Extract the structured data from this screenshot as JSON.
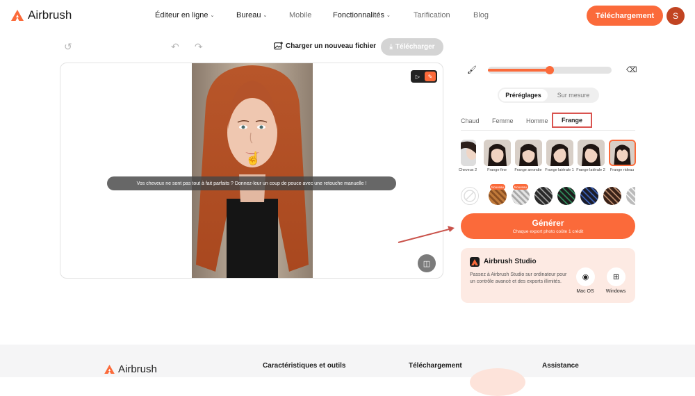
{
  "brand": {
    "name": "Airbrush",
    "accent": "#fb6a3a"
  },
  "nav": {
    "items": [
      {
        "label": "Éditeur en ligne",
        "has_dropdown": true
      },
      {
        "label": "Bureau",
        "has_dropdown": true
      },
      {
        "label": "Mobile",
        "has_dropdown": false
      },
      {
        "label": "Fonctionnalités",
        "has_dropdown": true
      },
      {
        "label": "Tarification",
        "has_dropdown": false
      },
      {
        "label": "Blog",
        "has_dropdown": false
      }
    ],
    "download_label": "Téléchargement",
    "avatar_initial": "S"
  },
  "toolbar": {
    "upload_label": "Charger un nouveau fichier",
    "download_label": "Télécharger"
  },
  "canvas": {
    "tip": "Vos cheveux ne sont pas tout à fait parfaits ? Donnez-leur un coup de pouce avec une retouche manuelle !"
  },
  "panel": {
    "brush_size": 0.5,
    "tabs": {
      "presets": "Préréglages",
      "custom": "Sur mesure"
    },
    "categories": [
      "Chaud",
      "Femme",
      "Homme",
      "Frange"
    ],
    "active_category": "Frange",
    "presets": [
      {
        "label": "Cheveux 2"
      },
      {
        "label": "Frange fine"
      },
      {
        "label": "Frange arrondie"
      },
      {
        "label": "Frange latérale 1"
      },
      {
        "label": "Frange latérale 2"
      },
      {
        "label": "Frange rideau"
      }
    ],
    "swatch_badges": [
      "Nouveau",
      "Nouveau"
    ],
    "generate": {
      "label": "Générer",
      "subtitle": "Chaque export photo coûte 1 crédit"
    },
    "studio": {
      "title": "Airbrush Studio",
      "text": "Passez à Airbrush Studio sur ordinateur pour un contrôle avancé et des exports illimités.",
      "mac_label": "Mac OS",
      "windows_label": "Windows"
    }
  },
  "footer": {
    "brand": "Airbrush",
    "columns": [
      "Caractéristiques et outils",
      "Téléchargement",
      "Assistance"
    ]
  }
}
